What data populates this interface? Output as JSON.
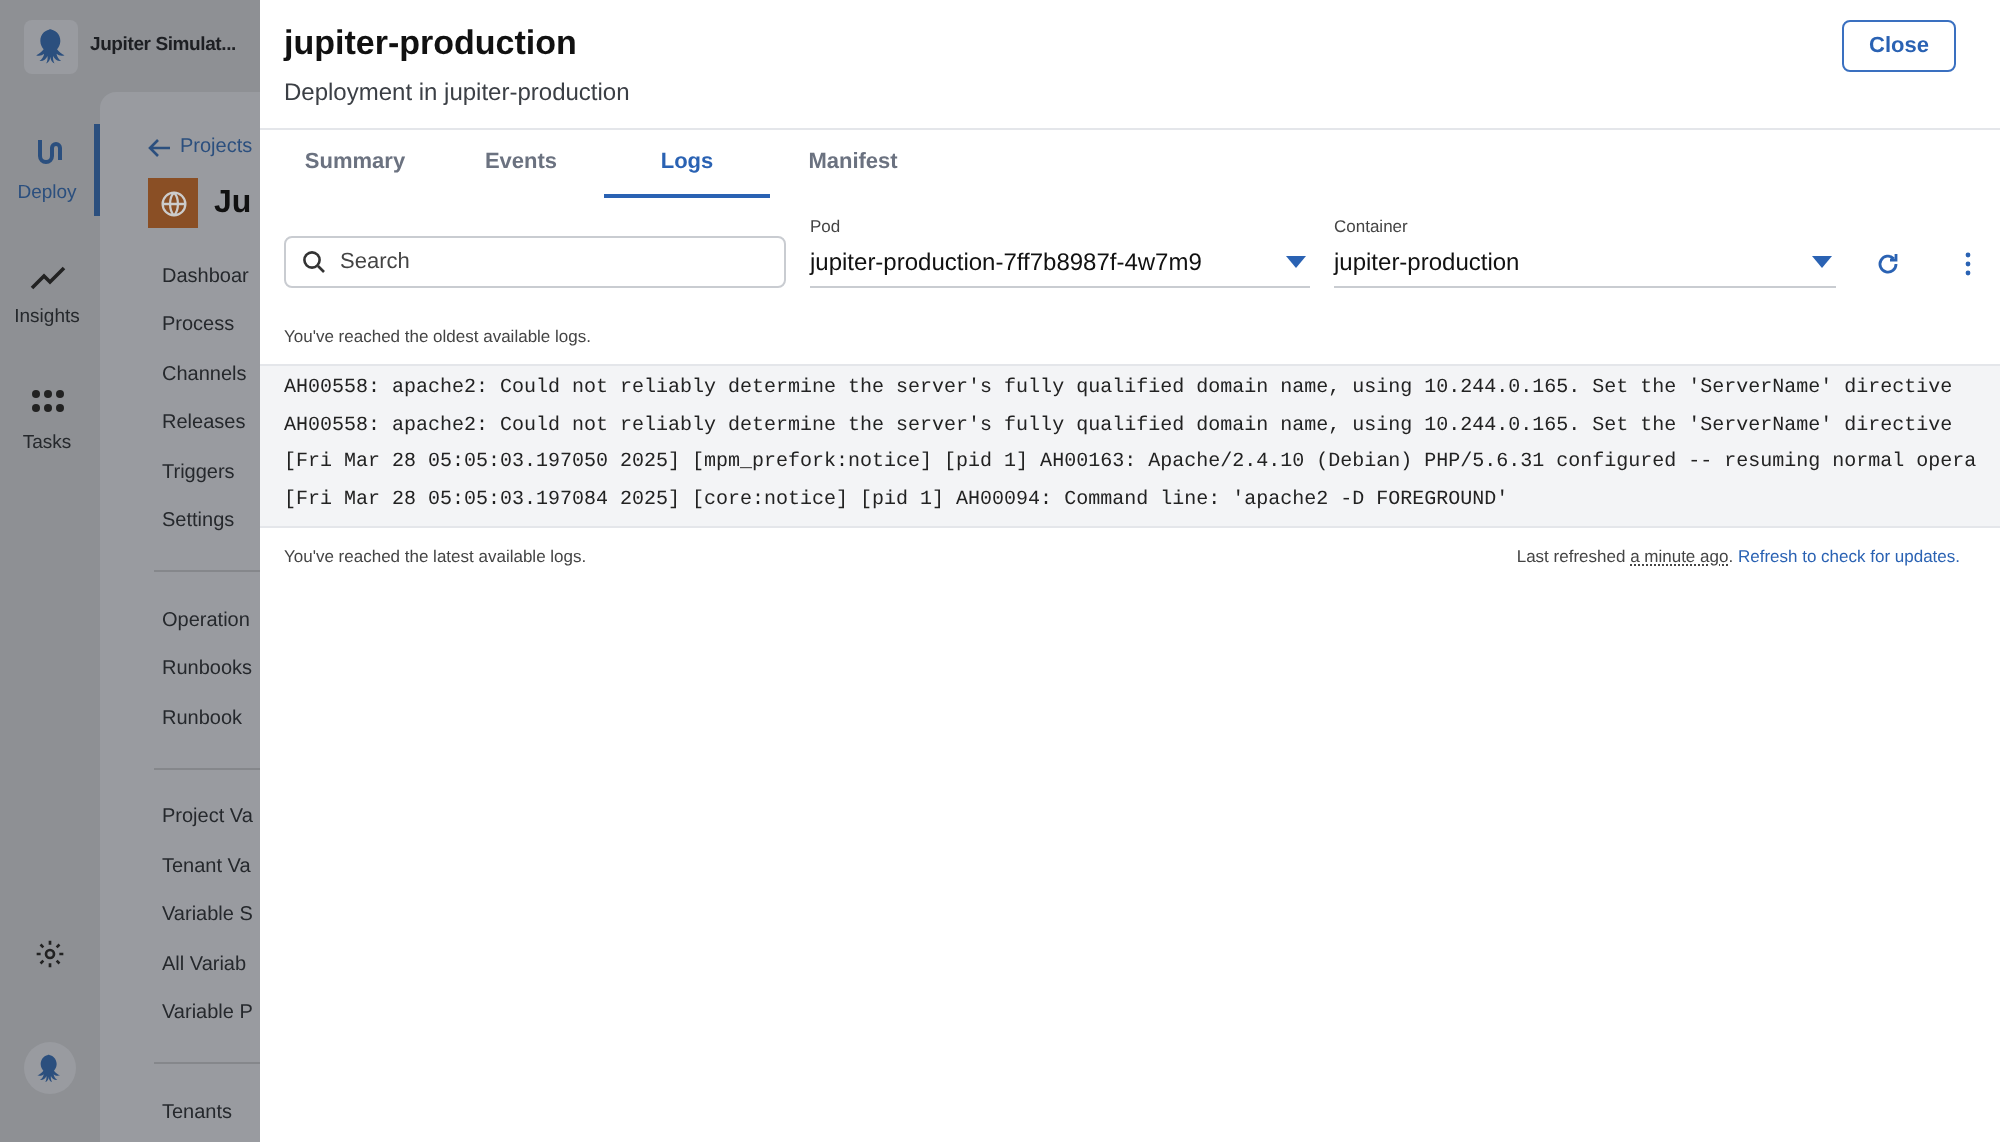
{
  "app": {
    "space_name": "Jupiter Simulat...",
    "rail": [
      {
        "label": "Deploy",
        "selected": true
      },
      {
        "label": "Insights",
        "selected": false
      },
      {
        "label": "Tasks",
        "selected": false
      }
    ]
  },
  "project_nav": {
    "back_link": "Projects",
    "project_title": "Ju",
    "groups": [
      [
        "Dashboar",
        "Process",
        "Channels",
        "Releases",
        "Triggers",
        "Settings"
      ],
      [
        "Operation",
        "Runbooks",
        "Runbook"
      ],
      [
        "Project Va",
        "Tenant Va",
        "Variable S",
        "All Variab",
        "Variable P"
      ],
      [
        "Tenants"
      ]
    ]
  },
  "drawer": {
    "title": "jupiter-production",
    "subtitle": "Deployment in jupiter-production",
    "close_button": "Close",
    "tabs": [
      {
        "label": "Summary",
        "selected": false
      },
      {
        "label": "Events",
        "selected": false
      },
      {
        "label": "Logs",
        "selected": true
      },
      {
        "label": "Manifest",
        "selected": false
      }
    ],
    "search": {
      "placeholder": "Search"
    },
    "pod": {
      "label": "Pod",
      "value": "jupiter-production-7ff7b8987f-4w7m9"
    },
    "container": {
      "label": "Container",
      "value": "jupiter-production"
    },
    "oldest_notice": "You've reached the oldest available logs.",
    "log_lines": [
      "AH00558: apache2: Could not reliably determine the server's fully qualified domain name, using 10.244.0.165. Set the 'ServerName' directive",
      "AH00558: apache2: Could not reliably determine the server's fully qualified domain name, using 10.244.0.165. Set the 'ServerName' directive",
      "[Fri Mar 28 05:05:03.197050 2025] [mpm_prefork:notice] [pid 1] AH00163: Apache/2.4.10 (Debian) PHP/5.6.31 configured -- resuming normal opera",
      "[Fri Mar 28 05:05:03.197084 2025] [core:notice] [pid 1] AH00094: Command line: 'apache2 -D FOREGROUND'"
    ],
    "latest_notice": "You've reached the latest available logs.",
    "refresh_prefix": "Last refreshed",
    "refresh_time": "a minute ago",
    "refresh_suffix": ".",
    "refresh_link": "Refresh to check for updates."
  }
}
